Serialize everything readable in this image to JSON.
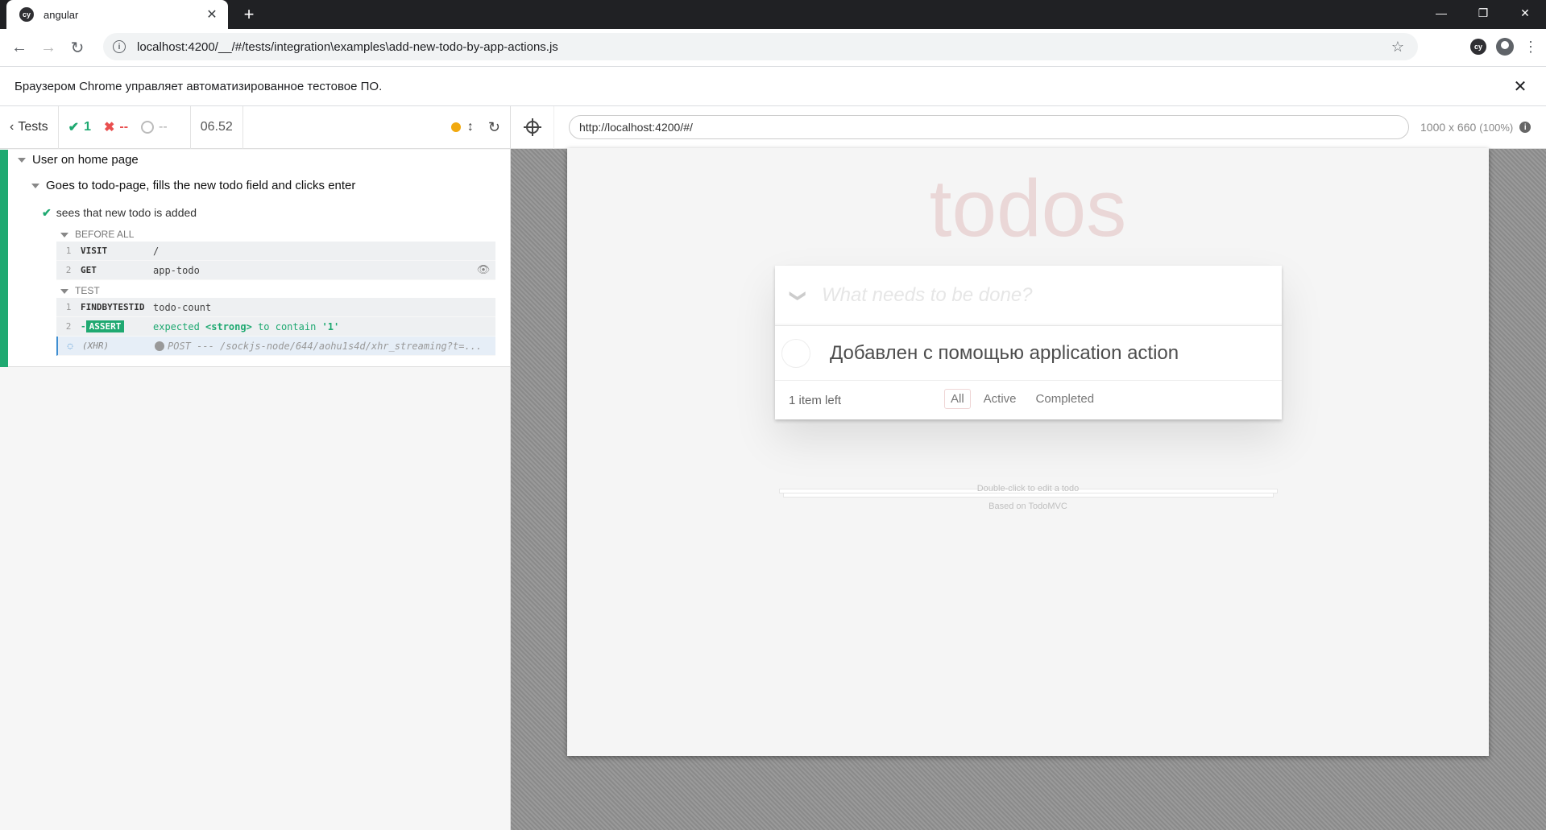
{
  "browser": {
    "tab_title": "angular",
    "tab_favicon": "cy",
    "new_tab": "+",
    "window_controls": {
      "minimize": "—",
      "restore": "❐",
      "close": "✕"
    },
    "url": "localhost:4200/__/#/tests/integration\\examples\\add-new-todo-by-app-actions.js",
    "extension_icon": "cy",
    "infobar_text": "Браузером Chrome управляет автоматизированное тестовое ПО.",
    "infobar_close": "✕"
  },
  "reporter": {
    "back_label": "Tests",
    "passed": "1",
    "failed": "--",
    "pending": "--",
    "duration": "06.52",
    "suite": "User on home page",
    "subsuite": "Goes to todo-page, fills the new todo field and clicks enter",
    "test": "sees that new todo is added",
    "before_all_label": "BEFORE ALL",
    "before_all": [
      {
        "num": "1",
        "name": "VISIT",
        "msg": "/"
      },
      {
        "num": "2",
        "name": "GET",
        "msg": "app-todo"
      }
    ],
    "test_label": "TEST",
    "test_cmds": {
      "c1": {
        "num": "1",
        "name": "FINDBYTESTID",
        "msg": "todo-count"
      },
      "c2": {
        "num": "2",
        "prefix": "-",
        "badge": "ASSERT",
        "w1": "expected",
        "w2": "<strong>",
        "w3": "to contain",
        "w4": "'1'"
      },
      "c3": {
        "name": "(XHR)",
        "msg": "POST --- /sockjs-node/644/aohu1s4d/xhr_streaming?t=..."
      }
    },
    "colors": {
      "pass": "#1fa971",
      "fail": "#e94f4f",
      "running": "#f1a90f"
    }
  },
  "aut": {
    "url": "http://localhost:4200/#/",
    "viewport": "1000 x 660",
    "scale": "(100%)",
    "app": {
      "title": "todos",
      "new_placeholder": "What needs to be done?",
      "toggle_all_icon": "❯",
      "item": "Добавлен с помощью application action",
      "count": "1 item left",
      "filters": {
        "all": "All",
        "active": "Active",
        "completed": "Completed"
      },
      "info1": "Double-click to edit a todo",
      "info2": "Based on TodoMVC"
    }
  }
}
